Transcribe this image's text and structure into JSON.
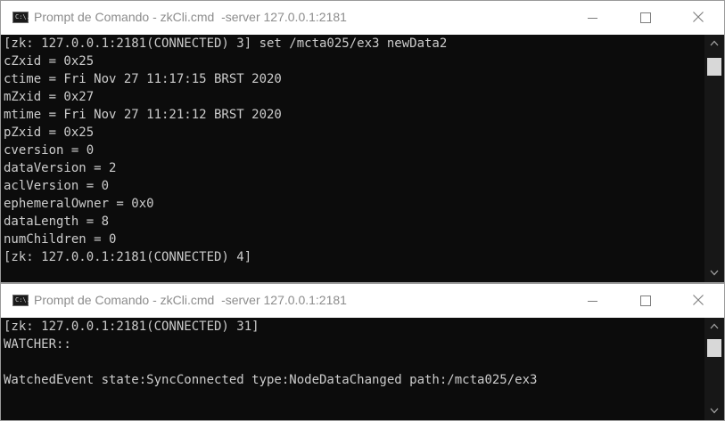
{
  "top_window": {
    "title": "Prompt de Comando - zkCli.cmd  -server 127.0.0.1:2181",
    "app_icon_text": "C:\\.",
    "console_lines": [
      "[zk: 127.0.0.1:2181(CONNECTED) 3] set /mcta025/ex3 newData2",
      "cZxid = 0x25",
      "ctime = Fri Nov 27 11:17:15 BRST 2020",
      "mZxid = 0x27",
      "mtime = Fri Nov 27 11:21:12 BRST 2020",
      "pZxid = 0x25",
      "cversion = 0",
      "dataVersion = 2",
      "aclVersion = 0",
      "ephemeralOwner = 0x0",
      "dataLength = 8",
      "numChildren = 0",
      "[zk: 127.0.0.1:2181(CONNECTED) 4]"
    ]
  },
  "bottom_window": {
    "title": "Prompt de Comando - zkCli.cmd  -server 127.0.0.1:2181",
    "app_icon_text": "C:\\.",
    "console_lines": [
      "[zk: 127.0.0.1:2181(CONNECTED) 31]",
      "WATCHER::",
      "",
      "WatchedEvent state:SyncConnected type:NodeDataChanged path:/mcta025/ex3"
    ]
  },
  "colors": {
    "console_bg": "#0c0c0c",
    "console_text": "#cccccc",
    "titlebar_bg": "#ffffff",
    "titlebar_text": "#8c8c8c"
  }
}
